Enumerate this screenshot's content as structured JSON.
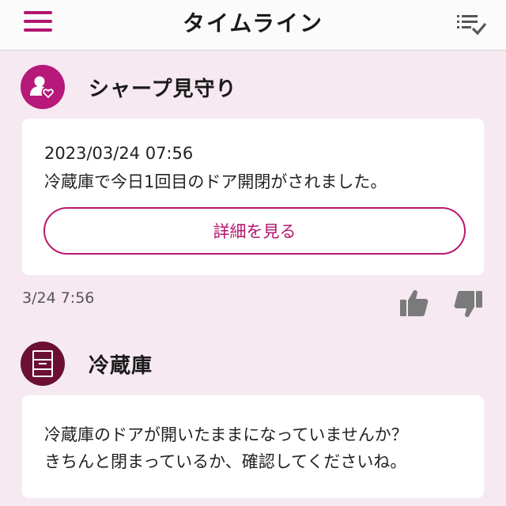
{
  "header": {
    "title": "タイムライン",
    "menu_icon": "hamburger-menu-icon",
    "filter_icon": "checklist-icon"
  },
  "timeline": [
    {
      "source": "シャープ見守り",
      "icon": "person-heart-icon",
      "datetime": "2023/03/24 07:56",
      "message": "冷蔵庫で今日1回目のドア開閉がされました。",
      "button_label": "詳細を見る",
      "posted_at": "3/24 7:56"
    },
    {
      "source": "冷蔵庫",
      "icon": "refrigerator-icon",
      "message_lines": [
        "冷蔵庫のドアが開いたままになっていませんか？",
        "きちんと閉まっているか、確認してくださいね。"
      ]
    }
  ],
  "colors": {
    "accent": "#b5156d",
    "background": "#f6e9f1",
    "card": "#ffffff",
    "fridge_avatar": "#6b1033"
  }
}
